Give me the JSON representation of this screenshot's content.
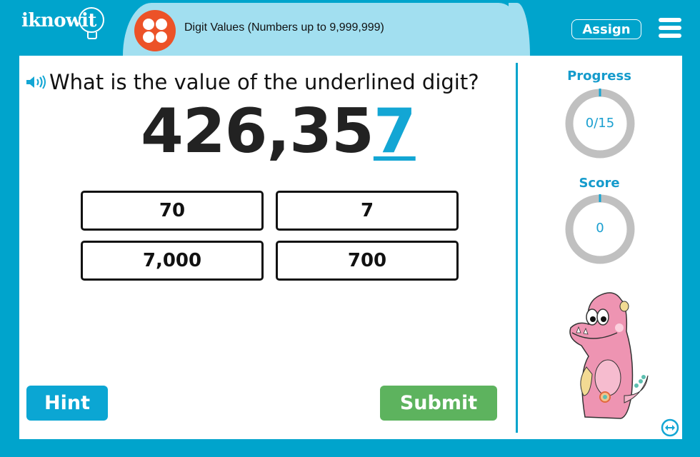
{
  "header": {
    "logo": "iknowit",
    "topic_title": "Digit Values (Numbers up to 9,999,999)",
    "assign_label": "Assign",
    "menu_icon": "hamburger-menu-icon",
    "topic_icon": "four-dots-icon"
  },
  "question": {
    "audio_icon": "speaker-icon",
    "prompt": "What is the value of the underlined digit?",
    "number_prefix": "426,35",
    "underlined_digit": "7"
  },
  "options": [
    {
      "label": "70"
    },
    {
      "label": "7"
    },
    {
      "label": "7,000"
    },
    {
      "label": "700"
    }
  ],
  "actions": {
    "hint_label": "Hint",
    "submit_label": "Submit"
  },
  "sidebar": {
    "progress_label": "Progress",
    "progress_value": "0/15",
    "progress_fraction": 0,
    "score_label": "Score",
    "score_value": "0",
    "score_fraction": 0,
    "mascot": "pink-monster-mascot",
    "expand_icon": "expand-arrows-icon"
  },
  "colors": {
    "frame": "#00a4cc",
    "title_pill": "#a2dff0",
    "topic_icon": "#ec5228",
    "accent": "#13a6d4",
    "hint": "#0ba6d3",
    "submit": "#5db35e",
    "ring_track": "#c0c0c0"
  }
}
